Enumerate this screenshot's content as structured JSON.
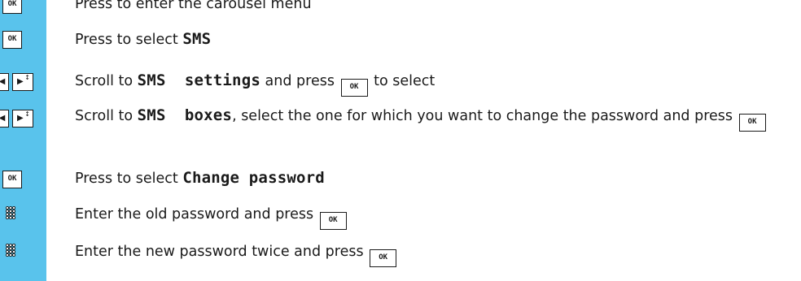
{
  "rows": [
    {
      "icon": "ok",
      "segments": [
        {
          "text": "Press to enter the carousel menu"
        }
      ]
    },
    {
      "icon": "ok",
      "segments": [
        {
          "text": "Press to select "
        },
        {
          "text": "SMS",
          "display": true
        }
      ]
    },
    {
      "icon": "scroll",
      "segments": [
        {
          "text": "Scroll to "
        },
        {
          "text": "SMS  settings",
          "display": true
        },
        {
          "text": " and press "
        },
        {
          "key": true
        },
        {
          "text": " to select"
        }
      ]
    },
    {
      "icon": "scroll",
      "segments": [
        {
          "text": "Scroll to "
        },
        {
          "text": "SMS  boxes",
          "display": true
        },
        {
          "text": ",  select the one for which you want to change the password and press "
        },
        {
          "key": true
        }
      ]
    },
    {
      "icon": "ok",
      "segments": [
        {
          "text": "Press to select "
        },
        {
          "text": "Change password",
          "display": true
        }
      ]
    },
    {
      "icon": "keypad",
      "segments": [
        {
          "text": "Enter the old password and press "
        },
        {
          "key": true
        }
      ]
    },
    {
      "icon": "keypad",
      "segments": [
        {
          "text": "Enter the new password twice and press "
        },
        {
          "key": true
        }
      ]
    }
  ],
  "ok_key_label": "OK",
  "colors": {
    "sidebar": "#59c3ec",
    "text": "#1a1a1a"
  }
}
